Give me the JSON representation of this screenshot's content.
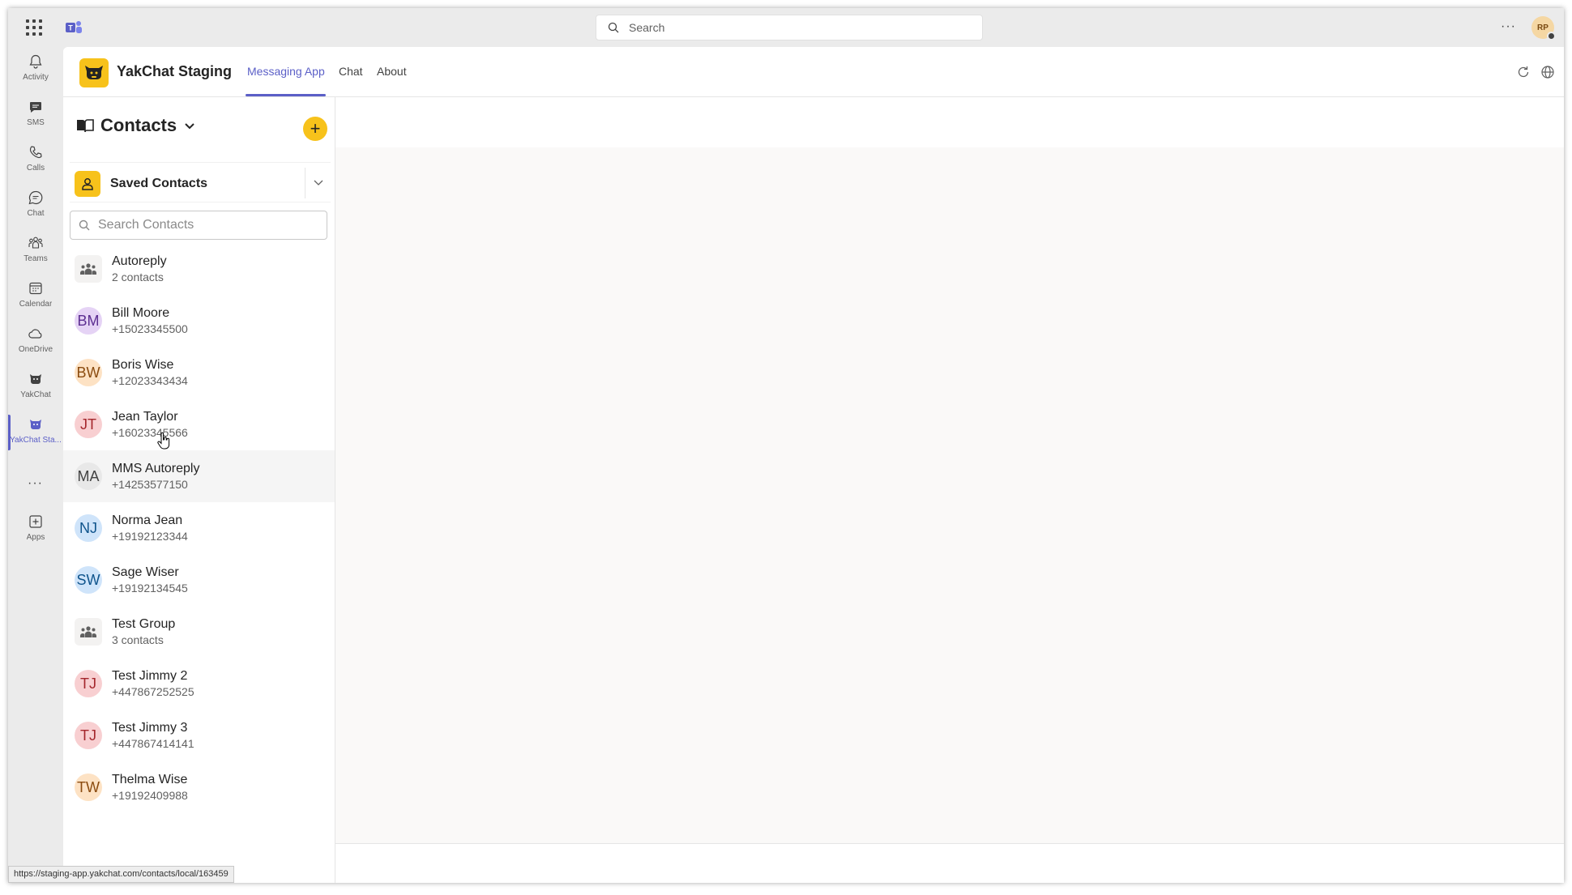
{
  "topbar": {
    "search_placeholder": "Search",
    "more_label": "···",
    "avatar_initials": "RP"
  },
  "rail": {
    "items": [
      {
        "label": "Activity",
        "icon": "bell-icon"
      },
      {
        "label": "SMS",
        "icon": "sms-icon"
      },
      {
        "label": "Calls",
        "icon": "phone-icon"
      },
      {
        "label": "Chat",
        "icon": "chat-icon"
      },
      {
        "label": "Teams",
        "icon": "teams-icon"
      },
      {
        "label": "Calendar",
        "icon": "calendar-icon"
      },
      {
        "label": "OneDrive",
        "icon": "cloud-icon"
      },
      {
        "label": "YakChat",
        "icon": "yakchat-icon"
      },
      {
        "label": "YakChat Sta...",
        "icon": "yakchat-staging-icon",
        "active": true
      },
      {
        "label": "Apps",
        "icon": "apps-plus-icon"
      }
    ],
    "more_label": "···"
  },
  "app": {
    "title": "YakChat Staging",
    "tabs": [
      {
        "label": "Messaging App",
        "active": true
      },
      {
        "label": "Chat"
      },
      {
        "label": "About"
      }
    ]
  },
  "contacts": {
    "title": "Contacts",
    "add_label": "+",
    "filter_label": "Saved Contacts",
    "search_placeholder": "Search Contacts",
    "items": [
      {
        "initials": "",
        "name": "Autoreply",
        "sub": "2 contacts",
        "group": true
      },
      {
        "initials": "BM",
        "name": "Bill Moore",
        "sub": "+15023345500",
        "bg": "#e5d3f5",
        "fg": "#5c2e91"
      },
      {
        "initials": "BW",
        "name": "Boris Wise",
        "sub": "+12023343434",
        "bg": "#fde2c4",
        "fg": "#8a4b0f"
      },
      {
        "initials": "JT",
        "name": "Jean Taylor",
        "sub": "+16023345566",
        "bg": "#f8cfd1",
        "fg": "#a4262c"
      },
      {
        "initials": "MA",
        "name": "MMS Autoreply",
        "sub": "+14253577150",
        "bg": "#e8e8e8",
        "fg": "#424242",
        "hover": true
      },
      {
        "initials": "NJ",
        "name": "Norma Jean",
        "sub": "+19192123344",
        "bg": "#cfe4fa",
        "fg": "#0f548c"
      },
      {
        "initials": "SW",
        "name": "Sage Wiser",
        "sub": "+19192134545",
        "bg": "#cfe4fa",
        "fg": "#0f548c"
      },
      {
        "initials": "",
        "name": "Test Group",
        "sub": "3 contacts",
        "group": true
      },
      {
        "initials": "TJ",
        "name": "Test Jimmy 2",
        "sub": "+447867252525",
        "bg": "#f8cfd1",
        "fg": "#a4262c"
      },
      {
        "initials": "TJ",
        "name": "Test Jimmy 3",
        "sub": "+447867414141",
        "bg": "#f8cfd1",
        "fg": "#a4262c"
      },
      {
        "initials": "TW",
        "name": "Thelma Wise",
        "sub": "+19192409988",
        "bg": "#fde2c4",
        "fg": "#8a4b0f"
      }
    ]
  },
  "status_url": "https://staging-app.yakchat.com/contacts/local/163459",
  "colors": {
    "accent": "#5b5fc7",
    "brand_yellow": "#f7c21b"
  }
}
